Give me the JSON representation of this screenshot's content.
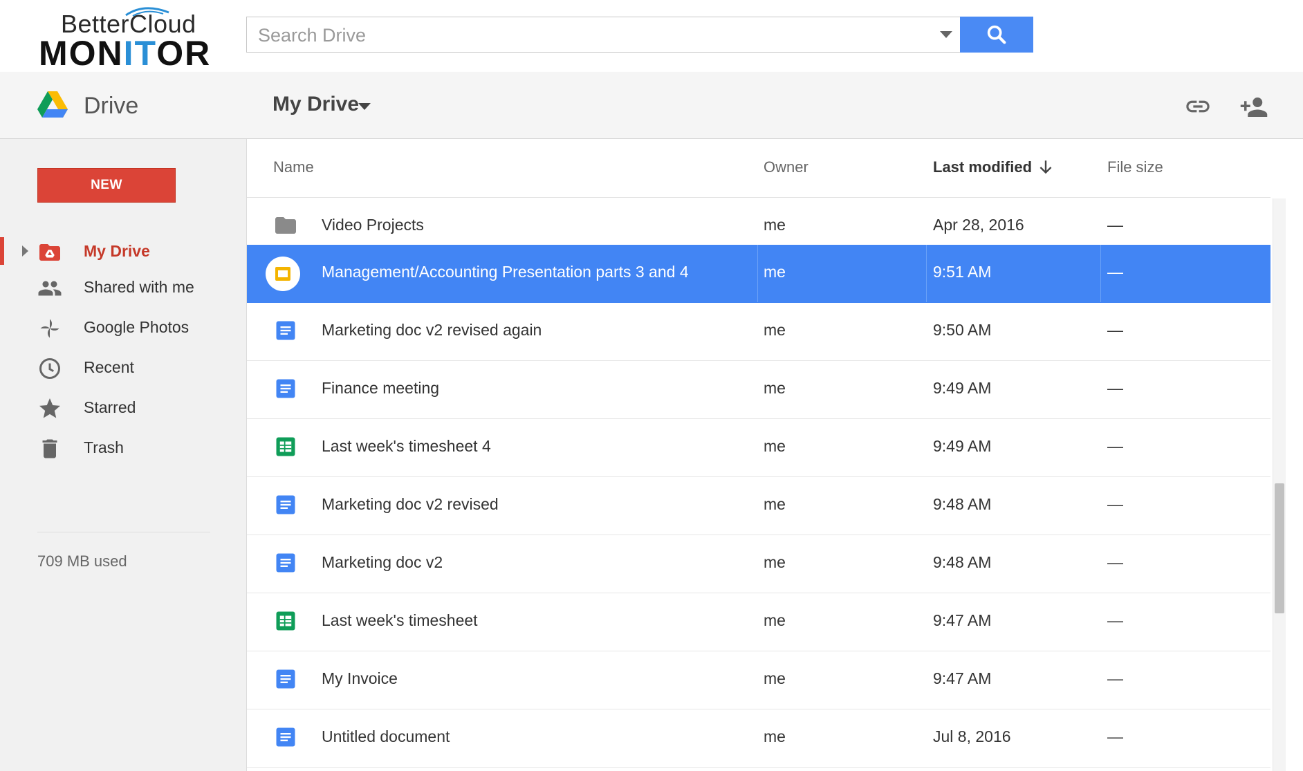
{
  "brand": {
    "line1": "BetterCloud",
    "line2_a": "MON",
    "line2_b": "IT",
    "line2_c": "OR"
  },
  "search": {
    "placeholder": "Search Drive",
    "value": ""
  },
  "header": {
    "app_title": "Drive",
    "location_title": "My Drive"
  },
  "sidebar": {
    "new_label": "NEW",
    "items": [
      {
        "label": "My Drive",
        "icon": "my-drive-icon"
      },
      {
        "label": "Shared with me",
        "icon": "people-icon"
      },
      {
        "label": "Google Photos",
        "icon": "photos-pinwheel-icon"
      },
      {
        "label": "Recent",
        "icon": "clock-icon"
      },
      {
        "label": "Starred",
        "icon": "star-icon"
      },
      {
        "label": "Trash",
        "icon": "trash-icon"
      }
    ],
    "storage": "709 MB used"
  },
  "columns": {
    "name": "Name",
    "owner": "Owner",
    "modified": "Last modified",
    "size": "File size"
  },
  "files": [
    {
      "name": "Video Projects",
      "owner": "me",
      "modified": "Apr 28, 2016",
      "size": "—",
      "type": "folder"
    },
    {
      "name": "Management/Accounting Presentation parts 3 and 4",
      "owner": "me",
      "modified": "9:51 AM",
      "size": "—",
      "type": "slides",
      "selected": true
    },
    {
      "name": "Marketing doc v2 revised again",
      "owner": "me",
      "modified": "9:50 AM",
      "size": "—",
      "type": "doc"
    },
    {
      "name": "Finance meeting",
      "owner": "me",
      "modified": "9:49 AM",
      "size": "—",
      "type": "doc"
    },
    {
      "name": "Last week's timesheet 4",
      "owner": "me",
      "modified": "9:49 AM",
      "size": "—",
      "type": "sheet"
    },
    {
      "name": "Marketing doc v2 revised",
      "owner": "me",
      "modified": "9:48 AM",
      "size": "—",
      "type": "doc"
    },
    {
      "name": "Marketing doc v2",
      "owner": "me",
      "modified": "9:48 AM",
      "size": "—",
      "type": "doc"
    },
    {
      "name": "Last week's timesheet",
      "owner": "me",
      "modified": "9:47 AM",
      "size": "—",
      "type": "sheet"
    },
    {
      "name": "My Invoice",
      "owner": "me",
      "modified": "9:47 AM",
      "size": "—",
      "type": "doc"
    },
    {
      "name": "Untitled document",
      "owner": "me",
      "modified": "Jul 8, 2016",
      "size": "—",
      "type": "doc"
    }
  ],
  "colors": {
    "accent": "#4285f4",
    "new_button": "#db4437",
    "doc": "#4285f4",
    "sheet": "#0f9d58",
    "slides": "#f4b400"
  }
}
